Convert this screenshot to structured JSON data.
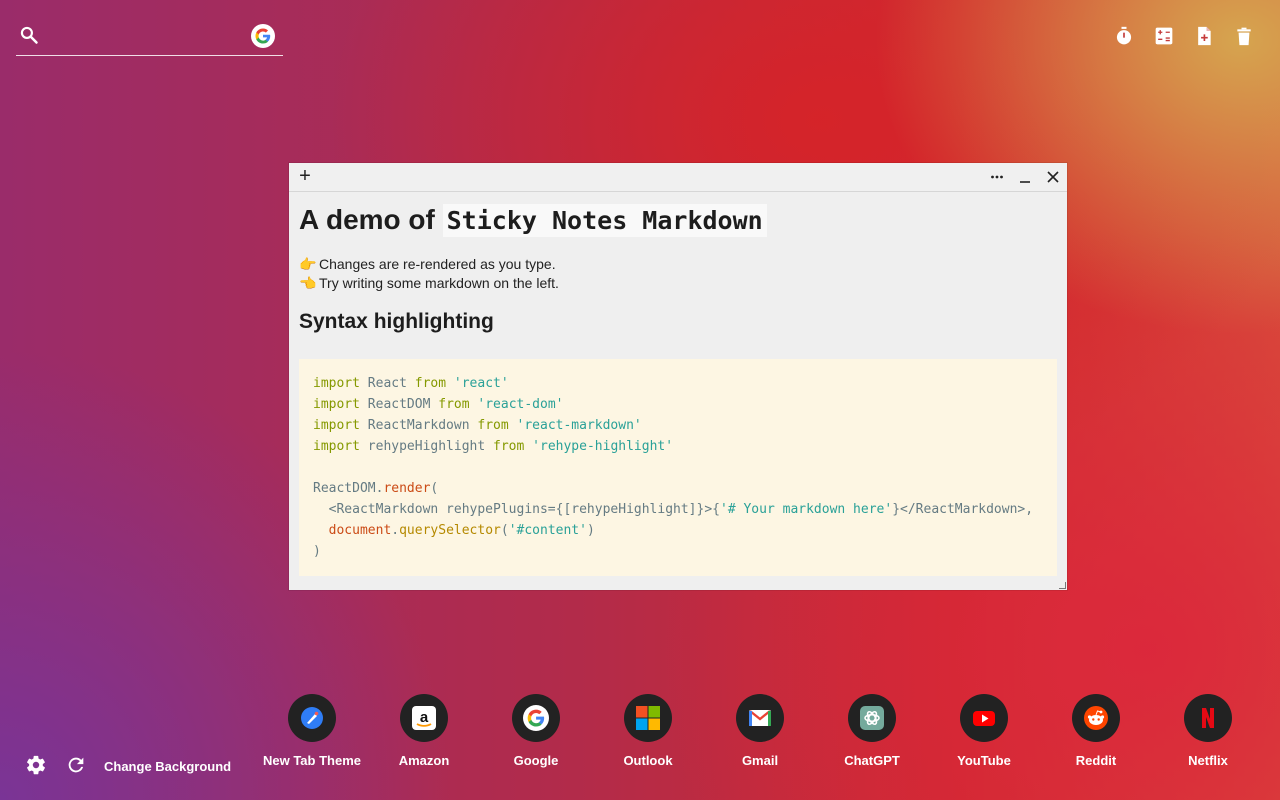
{
  "search": {
    "value": "",
    "placeholder": "",
    "engine_icon": "google-icon"
  },
  "tools": [
    {
      "name": "timer-icon"
    },
    {
      "name": "calculator-icon"
    },
    {
      "name": "new-note-icon"
    },
    {
      "name": "trash-icon"
    }
  ],
  "note": {
    "add_label": "+",
    "title_text": "A demo of ",
    "title_code": "Sticky Notes Markdown",
    "line1_emoji": "👉",
    "line1": "Changes are re-rendered as you type.",
    "line2_emoji": "👈",
    "line2": "Try writing some markdown on the left.",
    "subheading": "Syntax highlighting",
    "code": {
      "import": "import",
      "from": "from",
      "l1_name": " React ",
      "l1_str": "'react'",
      "l2_name": " ReactDOM ",
      "l2_str": "'react-dom'",
      "l3_name": " ReactMarkdown ",
      "l3_str": "'react-markdown'",
      "l4_name": " rehypeHighlight ",
      "l4_str": "'rehype-highlight'",
      "l5_obj": "ReactDOM",
      "l5_dot": ".",
      "l5_fn": "render",
      "l5_paren": "(",
      "l6_open": "  <ReactMarkdown rehypePlugins={[rehypeHighlight]}>{",
      "l6_str": "'# Your markdown here'",
      "l6_close": "}</ReactMarkdown>,",
      "l7_indent": "  ",
      "l7_obj": "document",
      "l7_dot": ".",
      "l7_fn": "querySelector",
      "l7_po": "(",
      "l7_str": "'#content'",
      "l7_pc": ")",
      "l8": ")"
    }
  },
  "shortcuts": [
    {
      "label": "New Tab Theme",
      "icon": "new-tab-theme-icon"
    },
    {
      "label": "Amazon",
      "icon": "amazon-icon"
    },
    {
      "label": "Google",
      "icon": "google-icon"
    },
    {
      "label": "Outlook",
      "icon": "outlook-icon"
    },
    {
      "label": "Gmail",
      "icon": "gmail-icon"
    },
    {
      "label": "ChatGPT",
      "icon": "chatgpt-icon"
    },
    {
      "label": "YouTube",
      "icon": "youtube-icon"
    },
    {
      "label": "Reddit",
      "icon": "reddit-icon"
    },
    {
      "label": "Netflix",
      "icon": "netflix-icon"
    }
  ],
  "bottom": {
    "change_background": "Change Background"
  },
  "colors": {
    "accent_red": "#d42a2e",
    "note_bg": "#efefef",
    "code_bg": "#fdf6e3"
  }
}
